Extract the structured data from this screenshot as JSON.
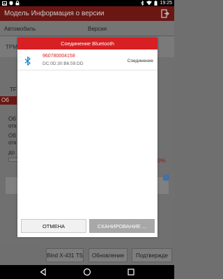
{
  "status_bar": {
    "time": "19:25",
    "icons": [
      "image-icon",
      "shield-icon",
      "lock-icon",
      "bluetooth-icon",
      "wifi-icon",
      "battery-icon"
    ]
  },
  "app_bar": {
    "title": "Модель Информация о версии",
    "exit_icon": "exit-icon",
    "color": "#d81f23"
  },
  "table": {
    "headers": [
      "Автомобиль",
      "Версия"
    ],
    "row_label": "TPM"
  },
  "background": {
    "t_label": "TF",
    "red_label": "Об",
    "line1": "Об",
    "line2": "отк",
    "line3": "Об",
    "line4": "отк",
    "line5": "до",
    "percent": "0%"
  },
  "bottom_buttons": [
    {
      "label": "Bind X-431 TS"
    },
    {
      "label": "Обновление"
    },
    {
      "label": "Подтвержде"
    }
  ],
  "dialog": {
    "title": "Соединение Bluetooth",
    "device": {
      "name": "960780004158",
      "mac": "DC:0D:30:B6:59:DD",
      "status": "Соединение",
      "icon": "bluetooth-icon"
    },
    "cancel_label": "ОТМЕНА",
    "scan_label": "СКАНИРОВАНИЕ ..."
  },
  "nav_bar": {
    "icons": [
      "back-icon",
      "home-icon",
      "recents-icon"
    ]
  }
}
